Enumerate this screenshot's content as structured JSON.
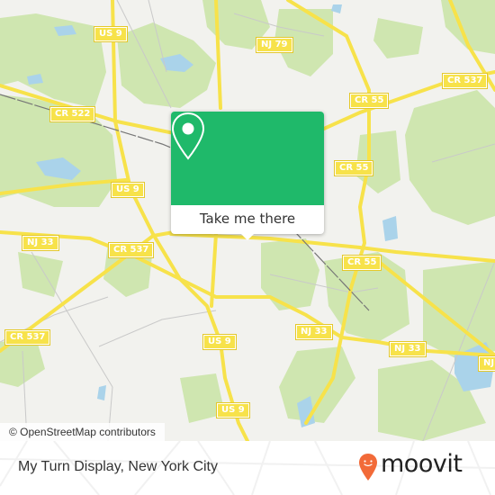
{
  "map": {
    "colors": {
      "background": "#f2f2ee",
      "forest": "#cfe6b0",
      "water": "#aad3ea",
      "road": "#f7e24a",
      "minor_road": "#c9c9c9",
      "rail": "#777777"
    },
    "road_labels": [
      {
        "id": "us9-north",
        "text": "US 9"
      },
      {
        "id": "nj79",
        "text": "NJ 79"
      },
      {
        "id": "cr537-ne",
        "text": "CR 537"
      },
      {
        "id": "cr522",
        "text": "CR 522"
      },
      {
        "id": "cr55-north",
        "text": "CR 55"
      },
      {
        "id": "cr55-mid",
        "text": "CR 55"
      },
      {
        "id": "us9-mid",
        "text": "US 9"
      },
      {
        "id": "nj33-west",
        "text": "NJ 33"
      },
      {
        "id": "cr537-mid",
        "text": "CR 537"
      },
      {
        "id": "cr55-south",
        "text": "CR 55"
      },
      {
        "id": "cr537-sw",
        "text": "CR 537"
      },
      {
        "id": "us9-south1",
        "text": "US 9"
      },
      {
        "id": "nj33-mid",
        "text": "NJ 33"
      },
      {
        "id": "nj33-east",
        "text": "NJ 33"
      },
      {
        "id": "nj-east-edge",
        "text": "NJ"
      },
      {
        "id": "us9-south2",
        "text": "US 9"
      }
    ],
    "attribution": "© OpenStreetMap contributors"
  },
  "popup": {
    "icon": "map-pin-icon",
    "button_label": "Take me there",
    "accent_color": "#1fb96a"
  },
  "footer": {
    "place_title": "My Turn Display, New York City",
    "brand": {
      "name": "moovit",
      "icon": "moovit-pin-icon",
      "color": "#f26a38"
    }
  }
}
